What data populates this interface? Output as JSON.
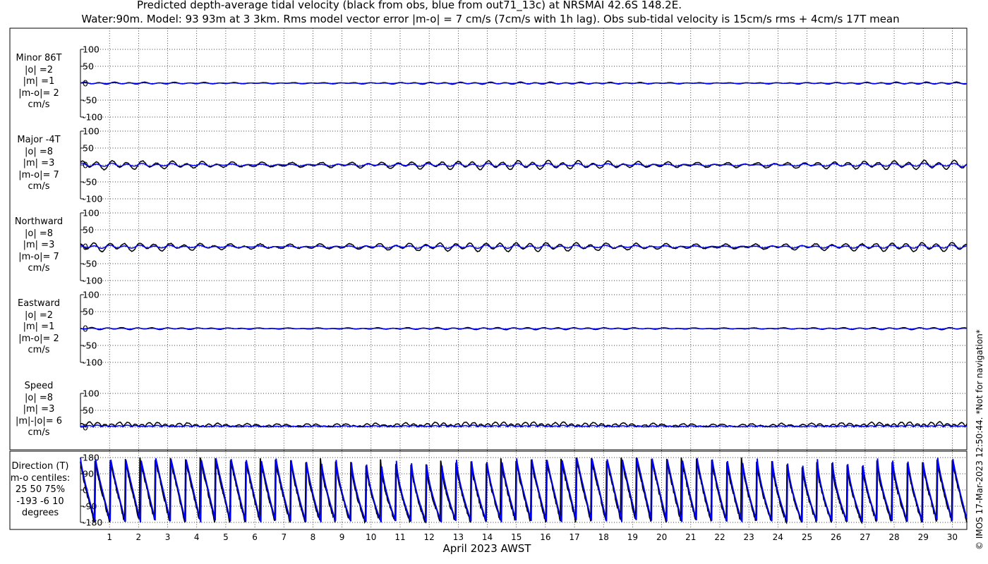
{
  "title_line1": "Predicted depth-average tidal velocity (black from obs, blue from out71_13c) at NRSMAI 42.6S 148.2E.",
  "title_line2": "Water:90m. Model: 93 93m at 3 3km. Rms model vector error |m-o| = 7 cm/s (7cm/s with 1h lag). Obs sub-tidal velocity is 15cm/s rms + 4cm/s 17T mean",
  "copyright": "© IMOS 17-Mar-2023 12:50:44. *Not for navigation*",
  "colors": {
    "obs": "#000000",
    "model": "#0000ff",
    "grid": "#000000"
  },
  "chart_data": [
    {
      "type": "line",
      "panel": "Minor 86T",
      "label_lines": [
        "Minor 86T",
        "|o| =2",
        "|m| =1",
        "|m-o|= 2",
        "cm/s"
      ],
      "ylim": [
        -100,
        100
      ],
      "yticks": [
        100,
        50,
        0,
        -50,
        -100
      ],
      "ytick_labels": [
        "100",
        "50",
        "0",
        "-50",
        "-100"
      ],
      "amplitude_obs": 2,
      "amplitude_model": 1,
      "series": [
        {
          "name": "obs",
          "color": "#000000"
        },
        {
          "name": "model",
          "color": "#0000ff"
        }
      ]
    },
    {
      "type": "line",
      "panel": "Major -4T",
      "label_lines": [
        "Major -4T",
        "|o| =8",
        "|m| =3",
        "|m-o|= 7",
        "cm/s"
      ],
      "ylim": [
        -100,
        100
      ],
      "yticks": [
        100,
        50,
        0,
        -50,
        -100
      ],
      "ytick_labels": [
        "100",
        "50",
        "0",
        "-50",
        "-100"
      ],
      "amplitude_obs": 8,
      "amplitude_model": 3,
      "series": [
        {
          "name": "obs",
          "color": "#000000"
        },
        {
          "name": "model",
          "color": "#0000ff"
        }
      ]
    },
    {
      "type": "line",
      "panel": "Northward",
      "label_lines": [
        "Northward",
        "|o| =8",
        "|m| =3",
        "|m-o|= 7",
        "cm/s"
      ],
      "ylim": [
        -100,
        100
      ],
      "yticks": [
        100,
        50,
        0,
        -50,
        -100
      ],
      "ytick_labels": [
        "100",
        "50",
        "0",
        "-50",
        "-100"
      ],
      "amplitude_obs": 8,
      "amplitude_model": 3,
      "series": [
        {
          "name": "obs",
          "color": "#000000"
        },
        {
          "name": "model",
          "color": "#0000ff"
        }
      ]
    },
    {
      "type": "line",
      "panel": "Eastward",
      "label_lines": [
        "Eastward",
        "|o| =2",
        "|m| =1",
        "|m-o|= 2",
        "cm/s"
      ],
      "ylim": [
        -100,
        100
      ],
      "yticks": [
        100,
        50,
        0,
        -50,
        -100
      ],
      "ytick_labels": [
        "100",
        "50",
        "0",
        "-50",
        "-100"
      ],
      "amplitude_obs": 2,
      "amplitude_model": 1,
      "series": [
        {
          "name": "obs",
          "color": "#000000"
        },
        {
          "name": "model",
          "color": "#0000ff"
        }
      ]
    },
    {
      "type": "line",
      "panel": "Speed",
      "label_lines": [
        "Speed",
        "|o| =8",
        "|m| =3",
        "|m|-|o|= 6",
        "cm/s"
      ],
      "ylim": [
        0,
        100
      ],
      "yticks": [
        100,
        50,
        0
      ],
      "ytick_labels": [
        "100",
        "50",
        "0"
      ],
      "amplitude_obs": 8,
      "amplitude_model": 3,
      "series": [
        {
          "name": "obs",
          "color": "#000000"
        },
        {
          "name": "model",
          "color": "#0000ff"
        }
      ]
    },
    {
      "type": "line",
      "panel": "Direction (T)",
      "label_lines": [
        "Direction (T)",
        "m-o centiles:",
        "25  50  75%",
        "-193   -6   10",
        "degrees"
      ],
      "ylim": [
        -180,
        180
      ],
      "yticks": [
        180,
        90,
        0,
        -90,
        -180
      ],
      "ytick_labels": [
        "180",
        "90",
        "0",
        "-90",
        "-180"
      ],
      "series": [
        {
          "name": "obs",
          "color": "#000000"
        },
        {
          "name": "model",
          "color": "#0000ff"
        }
      ]
    }
  ],
  "x_axis": {
    "label": "April 2023 AWST",
    "day_start": 0,
    "day_end": 30.5,
    "tick_labels": [
      "1",
      "2",
      "3",
      "4",
      "5",
      "6",
      "7",
      "8",
      "9",
      "10",
      "11",
      "12",
      "13",
      "14",
      "15",
      "16",
      "17",
      "18",
      "19",
      "20",
      "21",
      "22",
      "23",
      "24",
      "25",
      "26",
      "27",
      "28",
      "29",
      "30"
    ]
  }
}
